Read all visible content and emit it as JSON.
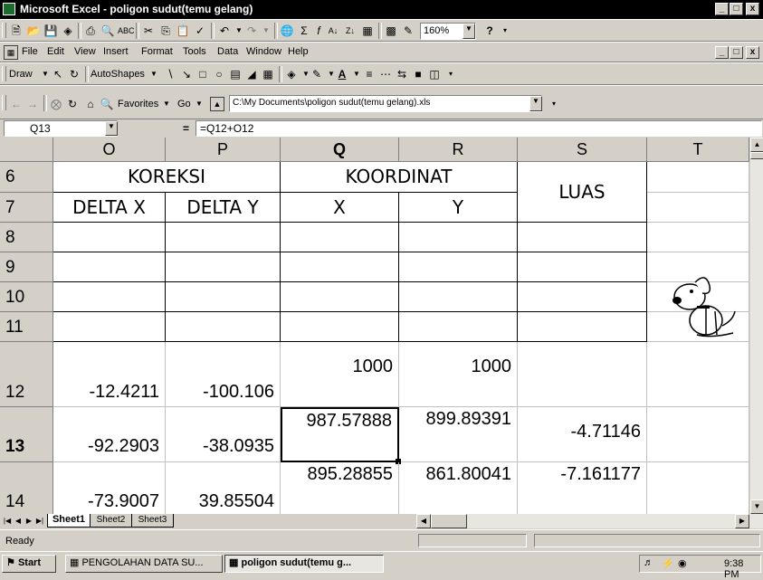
{
  "window": {
    "title": "Microsoft Excel - poligon sudut(temu gelang)",
    "minimize": "_",
    "restore": " ",
    "close": "x"
  },
  "menu": [
    "File",
    "Edit",
    "View",
    "Insert",
    "Format",
    "Tools",
    "Data",
    "Window",
    "Help"
  ],
  "standard_toolbar": {
    "zoom": "160%",
    "help": "?"
  },
  "drawing_toolbar": {
    "draw": "Draw",
    "autoshapes": "AutoShapes"
  },
  "web_toolbar": {
    "favorites": "Favorites",
    "go": "Go",
    "address": "C:\\My Documents\\poligon sudut(temu gelang).xls"
  },
  "formula_bar": {
    "name_box": "Q13",
    "equals": "=",
    "formula": "=Q12+O12"
  },
  "columns": [
    "O",
    "P",
    "Q",
    "R",
    "S",
    "T"
  ],
  "rows": [
    "6",
    "7",
    "8",
    "9",
    "10",
    "11",
    "12",
    "13",
    "14"
  ],
  "cells": {
    "koreksi": "KOREKSI",
    "koordinat": "KOORDINAT",
    "luas": "LUAS",
    "delta_x": "DELTA X",
    "delta_y": "DELTA Y",
    "x": "X",
    "y": "Y",
    "r12_o": "-12.4211",
    "r12_p": "-100.106",
    "r12_q": "1000",
    "r12_r": "1000",
    "r13_o": "-92.2903",
    "r13_p": "-38.0935",
    "r13_q": "987.57888",
    "r13_r": "899.89391",
    "r13_s": "-4.71146",
    "r14_o": "-73.9007",
    "r14_p": "39.85504",
    "r14_q": "895.28855",
    "r14_r": "861.80041",
    "r14_s": "-7.161177"
  },
  "sheet_tabs": [
    "Sheet1",
    "Sheet2",
    "Sheet3"
  ],
  "active_sheet": "Sheet1",
  "status": "Ready",
  "taskbar": {
    "start": "Start",
    "task1": "PENGOLAHAN DATA SU...",
    "task2": "poligon sudut(temu g...",
    "clock": "9:38 PM"
  },
  "colors": {
    "title_bg": "#000000",
    "chrome": "#d4d0c8",
    "grid": "#c0c0c0"
  },
  "icons": [
    "excel-icon",
    "new-icon",
    "open-icon",
    "save-icon",
    "print-icon",
    "print-preview-icon",
    "spelling-icon",
    "cut-icon",
    "copy-icon",
    "paste-icon",
    "format-painter-icon",
    "undo-icon",
    "redo-icon",
    "hyperlink-icon",
    "autosum-icon",
    "function-icon",
    "sort-ascending-icon",
    "sort-descending-icon",
    "chart-wizard-icon",
    "drawing-icon",
    "office-assistant-dog-icon"
  ]
}
